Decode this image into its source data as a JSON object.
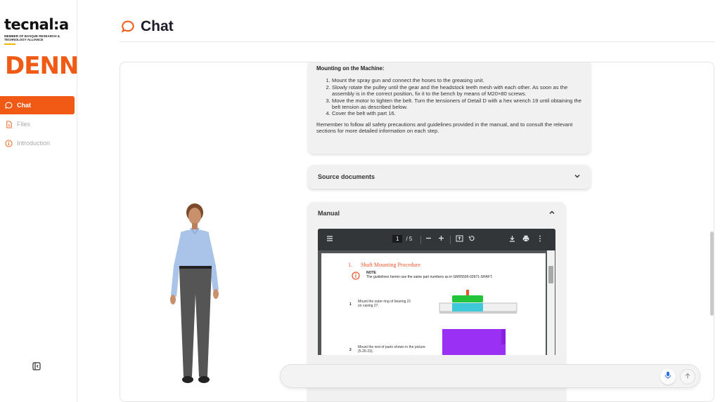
{
  "brand": {
    "org_name": "tecnal:a",
    "org_subtitle": "MEMBER OF BASQUE RESEARCH & TECHNOLOGY ALLIANCE",
    "product_logo": "DENN"
  },
  "sidebar": {
    "items": [
      {
        "label": "Chat",
        "icon": "chat-bubble-icon",
        "active": true
      },
      {
        "label": "Files",
        "icon": "file-icon",
        "active": false
      },
      {
        "label": "Introduction",
        "icon": "info-icon",
        "active": false
      }
    ],
    "collapse_icon": "sidebar-collapse-icon"
  },
  "header": {
    "title": "Chat",
    "icon": "chat-bubble-icon"
  },
  "answer": {
    "heading": "Mounting on the Machine:",
    "steps": [
      "Mount the spray gun and connect the hoses to the greasing unit.",
      "Slowly rotate the pulley until the gear and the headstock teeth mesh with each other. As soon as the assembly is in the correct position, fix it to the bench by means of M20×80 screws.",
      "Move the motor to tighten the belt. Turn the tensioners of Detail D with a hex wrench 19 until obtaining the belt tension as described below.",
      "Cover the belt with part 16."
    ],
    "closing": "Remember to follow all safety precautions and guidelines provided in the manual, and to consult the relevant sections for more detailed information on each step."
  },
  "source_documents": {
    "label": "Source documents",
    "expanded": false
  },
  "manual": {
    "label": "Manual",
    "expanded": true,
    "pdf": {
      "current_page": "1",
      "total_pages": "/ 5",
      "section_number": "1.",
      "section_title": "Shaft Mounting Procedure",
      "note_label": "NOTE",
      "note_text": "The guidelines herein use the same part numbers as in GM55506-03971-SHAFT.",
      "steps": [
        {
          "num": "1",
          "text": "Mount the outer ring of bearing 21 on casing 27."
        },
        {
          "num": "2",
          "text": "Mount the rest of parts shown in the picture (5-26-23)."
        }
      ]
    }
  },
  "input": {
    "value": "",
    "placeholder": ""
  },
  "colors": {
    "accent": "#f05a14",
    "pdf_toolbar": "#323639",
    "card_bg": "#f1f1f1"
  }
}
